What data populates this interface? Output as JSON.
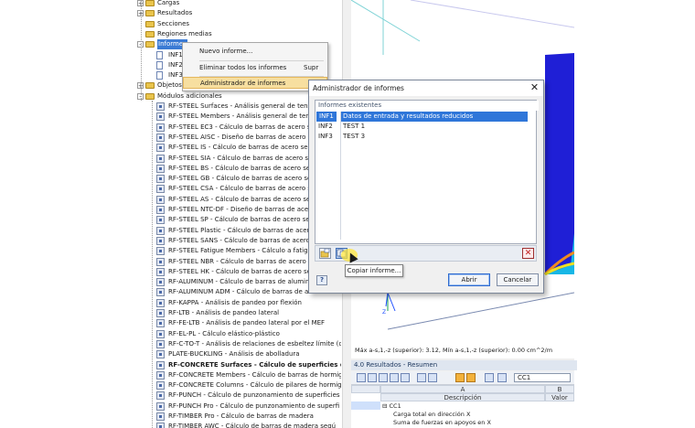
{
  "tree": {
    "items": [
      {
        "label": "Cargas",
        "indent": 1,
        "type": "folder",
        "toggle": "+"
      },
      {
        "label": "Resultados",
        "indent": 1,
        "type": "folder",
        "toggle": "+"
      },
      {
        "label": "Secciones",
        "indent": 1,
        "type": "folder",
        "toggle": ""
      },
      {
        "label": "Regiones medias",
        "indent": 1,
        "type": "folder",
        "toggle": ""
      },
      {
        "label": "Informes",
        "indent": 1,
        "type": "folder",
        "toggle": "-",
        "highlight": true
      },
      {
        "label": "INF1",
        "indent": 2,
        "type": "doc",
        "toggle": ""
      },
      {
        "label": "INF2",
        "indent": 2,
        "type": "doc",
        "toggle": ""
      },
      {
        "label": "INF3",
        "indent": 2,
        "type": "doc",
        "toggle": ""
      },
      {
        "label": "Objetos",
        "indent": 1,
        "type": "folder",
        "toggle": "+"
      },
      {
        "label": "Módulos adicionales",
        "indent": 1,
        "type": "folder",
        "toggle": "-"
      }
    ],
    "modules": [
      {
        "name": "RF-STEEL Surfaces",
        "desc": " - Análisis general de tensio"
      },
      {
        "name": "RF-STEEL Members",
        "desc": " - Análisis general de tensio"
      },
      {
        "name": "RF-STEEL EC3",
        "desc": " - Cálculo de barras de acero seg"
      },
      {
        "name": "RF-STEEL AISC",
        "desc": " - Diseño de barras de acero seg"
      },
      {
        "name": "RF-STEEL IS",
        "desc": " - Cálculo de barras de acero seg"
      },
      {
        "name": "RF-STEEL SIA",
        "desc": " - Cálculo de barras de acero seg"
      },
      {
        "name": "RF-STEEL BS",
        "desc": " - Cálculo de barras de acero seg"
      },
      {
        "name": "RF-STEEL GB",
        "desc": " - Cálculo de barras de acero seg"
      },
      {
        "name": "RF-STEEL CSA",
        "desc": " - Cálculo de barras de acero seg"
      },
      {
        "name": "RF-STEEL AS",
        "desc": " - Cálculo de barras de acero seg"
      },
      {
        "name": "RF-STEEL NTC-DF",
        "desc": " - Diseño de barras de acero se"
      },
      {
        "name": "RF-STEEL SP",
        "desc": " - Cálculo de barras de acero seg"
      },
      {
        "name": "RF-STEEL Plastic",
        "desc": " - Cálculo de barras de acero"
      },
      {
        "name": "RF-STEEL SANS",
        "desc": " - Cálculo de barras de acero s"
      },
      {
        "name": "RF-STEEL Fatigue Members",
        "desc": " - Cálculo a fatiga"
      },
      {
        "name": "RF-STEEL NBR",
        "desc": " - Cálculo de barras de acero seg"
      },
      {
        "name": "RF-STEEL HK",
        "desc": " - Cálculo de barras de acero seg"
      },
      {
        "name": "RF-ALUMINUM",
        "desc": " - Cálculo de barras de alumin"
      },
      {
        "name": "RF-ALUMINUM ADM",
        "desc": " - Cálculo de barras de aluminio s"
      },
      {
        "name": "RF-KAPPA",
        "desc": " - Análisis de pandeo por flexión"
      },
      {
        "name": "RF-LTB",
        "desc": " - Análisis de pandeo lateral"
      },
      {
        "name": "RF-FE-LTB",
        "desc": " - Análisis de pandeo lateral por el MEF"
      },
      {
        "name": "RF-EL-PL",
        "desc": " - Cálculo elástico-plástico"
      },
      {
        "name": "RF-C-TO-T",
        "desc": " - Análisis de relaciones de esbeltez límite (c"
      },
      {
        "name": "PLATE-BUCKLING",
        "desc": " - Análisis de abolladura"
      },
      {
        "name": "RF-CONCRETE Surfaces",
        "desc": " - Cálculo de superficies de ho",
        "bold": true
      },
      {
        "name": "RF-CONCRETE Members",
        "desc": " - Cálculo de barras de hormig"
      },
      {
        "name": "RF-CONCRETE Columns",
        "desc": " - Cálculo de pilares de hormig"
      },
      {
        "name": "RF-PUNCH",
        "desc": " - Cálculo de punzonamiento de superficies"
      },
      {
        "name": "RF-PUNCH Pro",
        "desc": " - Cálculo de punzonamiento de superfi"
      },
      {
        "name": "RF-TIMBER Pro",
        "desc": " - Cálculo de barras de madera"
      },
      {
        "name": "RF-TIMBER AWC",
        "desc": " - Cálculo de barras de madera segú"
      }
    ]
  },
  "context_menu": {
    "items": [
      {
        "label": "Nuevo informe...",
        "shortcut": ""
      },
      {
        "label": "Eliminar todos los informes",
        "shortcut": "Supr"
      },
      {
        "label": "Administrador de informes",
        "shortcut": ""
      }
    ]
  },
  "dialog": {
    "title": "Administrador de informes",
    "close": "✕",
    "list_header": "Informes existentes",
    "reports": [
      {
        "id": "INF1",
        "desc": "Datos de entrada y resultados reducidos"
      },
      {
        "id": "INF2",
        "desc": "TEST 1"
      },
      {
        "id": "INF3",
        "desc": "TEST 3"
      }
    ],
    "tooltip": "Copiar informe...",
    "help": "?",
    "open_label": "Abrir",
    "cancel_label": "Cancelar",
    "delete_symbol": "✕"
  },
  "view": {
    "status": "Máx a-s,1,-z (superior): 3.12, Mín a-s,1,-z (superior): 0.00 cm^2/m",
    "axis_label": "Z"
  },
  "results": {
    "title": "4.0 Resultados - Resumen",
    "combo_value": "CC1",
    "col_a": "A",
    "col_b": "B",
    "col_desc": "Descripción",
    "col_value": "Valor",
    "row_group": "CC1",
    "row_1": "Carga total en dirección X",
    "row_2": "Suma de fuerzas en apoyos en X"
  },
  "colors": {
    "accent": "#2f76d9",
    "highlight_menu": "#f7dfa0",
    "folder": "#e9c44c"
  }
}
